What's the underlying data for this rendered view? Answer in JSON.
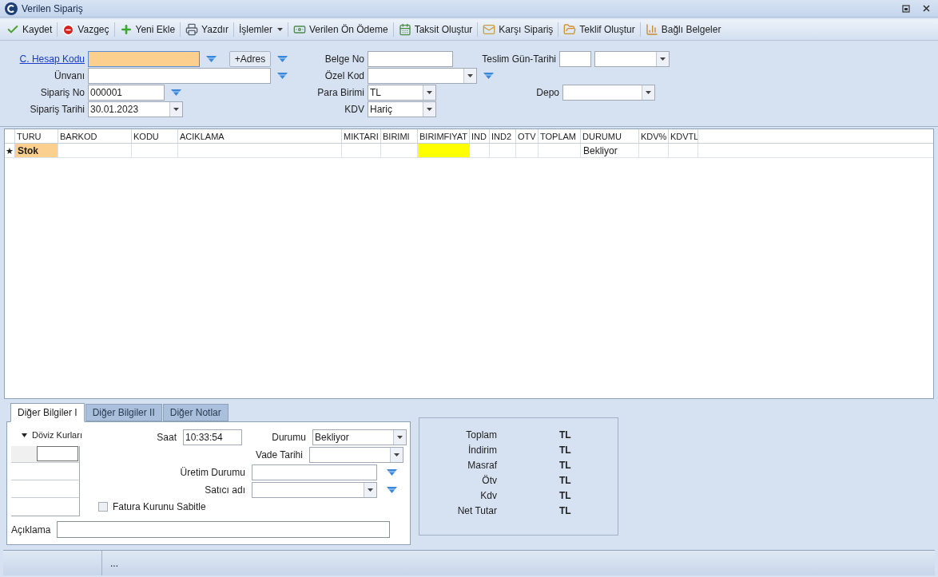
{
  "window": {
    "title": "Verilen Sipariş"
  },
  "toolbar": [
    {
      "label": "Kaydet",
      "kind": "save"
    },
    {
      "label": "Vazgeç",
      "kind": "cancel"
    },
    {
      "label": "Yeni Ekle",
      "kind": "add"
    },
    {
      "label": "Yazdır",
      "kind": "print"
    },
    {
      "label": "İşlemler",
      "kind": "menu"
    },
    {
      "label": "Verilen Ön Ödeme",
      "kind": "payment"
    },
    {
      "label": "Taksit Oluştur",
      "kind": "calendar"
    },
    {
      "label": "Karşı Sipariş",
      "kind": "mail"
    },
    {
      "label": "Teklif Oluştur",
      "kind": "folder"
    },
    {
      "label": "Bağlı Belgeler",
      "kind": "docs"
    }
  ],
  "header": {
    "left": [
      {
        "label": "C. Hesap Kodu",
        "link": true,
        "focused": true,
        "filter": true,
        "button": "+Adres",
        "controls": [
          {
            "kind": "text"
          }
        ]
      },
      {
        "label": "Ünvanı",
        "filter": true,
        "controls": [
          {
            "kind": "text"
          }
        ]
      },
      {
        "label": "Sipariş No",
        "filter": true,
        "controls": [
          {
            "kind": "text",
            "value": "000001"
          }
        ]
      },
      {
        "label": "Sipariş Tarihi",
        "controls": [
          {
            "kind": "combo",
            "value": "30.01.2023"
          }
        ]
      }
    ],
    "middle": [
      {
        "label": "Belge No",
        "controls": [
          {
            "kind": "text"
          }
        ]
      },
      {
        "label": "Özel Kod",
        "filter": true,
        "controls": [
          {
            "kind": "combo"
          }
        ]
      },
      {
        "label": "Para Birimi",
        "controls": [
          {
            "kind": "combo",
            "value": "TL"
          }
        ]
      },
      {
        "label": "KDV",
        "controls": [
          {
            "kind": "combo",
            "value": "Hariç"
          }
        ]
      }
    ],
    "right": [
      {
        "label": "Teslim Gün-Tarihi",
        "controls": [
          {
            "kind": "text"
          },
          {
            "kind": "combo"
          }
        ]
      },
      {
        "label": "Depo",
        "controls": [
          {
            "kind": "combo"
          }
        ]
      }
    ]
  },
  "grid": {
    "columns": [
      "TURU",
      "BARKOD",
      "KODU",
      "ACIKLAMA",
      "MIKTARI",
      "BIRIMI",
      "BIRIMFIYAT",
      "IND",
      "IND2",
      "OTV",
      "TOPLAM",
      "DURUMU",
      "KDV%",
      "KDVTL"
    ],
    "rows": [
      {
        "marker": "★",
        "cells": [
          {
            "text": "Stok",
            "bold": true,
            "color": "#fbcf8e"
          },
          {},
          {},
          {},
          {},
          {},
          {
            "color": "#ffff00"
          },
          {},
          {},
          {},
          {},
          {
            "text": "Bekliyor"
          },
          {},
          {}
        ]
      }
    ]
  },
  "tabs": [
    {
      "label": "Diğer Bilgiler I",
      "selected": true
    },
    {
      "label": "Diğer Bilgiler II",
      "selected": false
    },
    {
      "label": "Diğer Notlar",
      "selected": false
    }
  ],
  "details": {
    "currency": {
      "label": "Döviz Kurları",
      "expanded": true
    },
    "fields": [
      {
        "label": "Saat",
        "kind": "text",
        "value": "10:33:54"
      },
      {
        "label": "Durumu",
        "kind": "combo",
        "value": "Bekliyor"
      },
      {
        "label": "Vade Tarihi",
        "kind": "combo"
      },
      {
        "label": "Üretim Durumu",
        "kind": "text",
        "filter": true
      },
      {
        "label": "Satıcı adı",
        "kind": "combo",
        "filter": true
      }
    ],
    "checkbox": {
      "label": "Fatura Kurunu Sabitle",
      "checked": false
    },
    "note": {
      "label": "Açıklama"
    }
  },
  "totals": [
    {
      "label": "Toplam",
      "value": "TL"
    },
    {
      "label": "İndirim",
      "value": "TL"
    },
    {
      "label": "Masraf",
      "value": "TL"
    },
    {
      "label": "Ötv",
      "value": "TL"
    },
    {
      "label": "Kdv",
      "value": "TL"
    },
    {
      "label": "Net Tutar",
      "value": "TL"
    }
  ],
  "status_bar": {
    "text": "..."
  }
}
